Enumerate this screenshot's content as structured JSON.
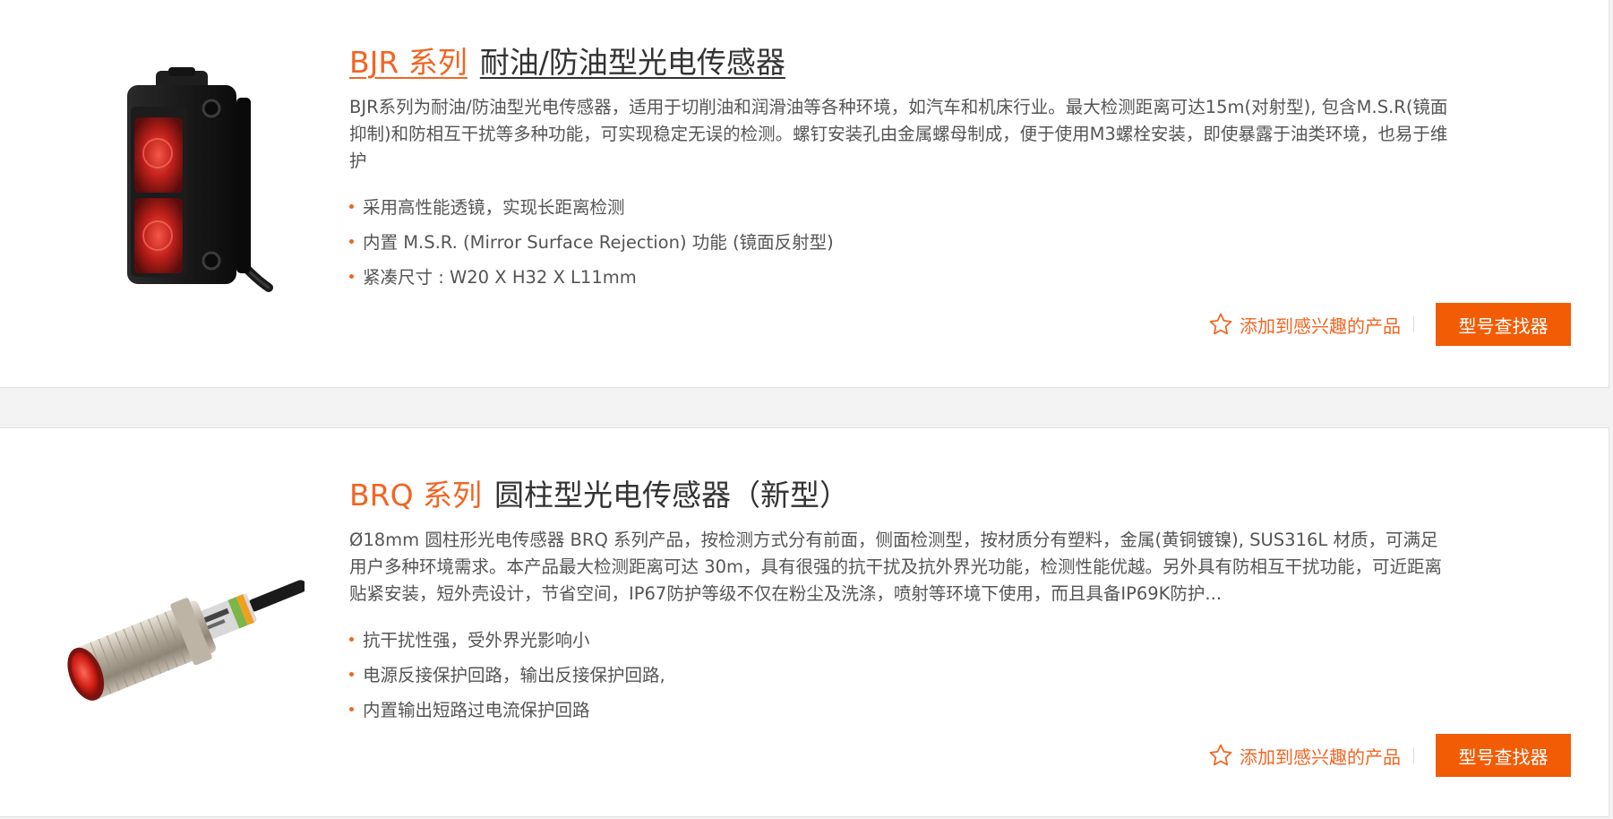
{
  "products": [
    {
      "series": "BJR 系列",
      "name": "耐油/防油型光电传感器",
      "description": "BJR系列为耐油/防油型光电传感器，适用于切削油和润滑油等各种环境，如汽车和机床行业。最大检测距离可达15m(对射型), 包含M.S.R(镜面抑制)和防相互干扰等多种功能，可实现稳定无误的检测。螺钉安装孔由金属螺母制成，便于使用M3螺栓安装，即使暴露于油类环境，也易于维护",
      "features": [
        "采用高性能透镜，实现长距离检测",
        "内置 M.S.R. (Mirror Surface Rejection) 功能 (镜面反射型)",
        "紧凑尺寸 : W20 X H32 X L11mm"
      ],
      "favorite_label": "添加到感兴趣的产品",
      "finder_label": "型号查找器"
    },
    {
      "series": "BRQ 系列",
      "name": "圆柱型光电传感器（新型）",
      "description": "Ø18mm 圆柱形光电传感器 BRQ 系列产品，按检测方式分有前面，侧面检测型，按材质分有塑料，金属(黄铜镀镍), SUS316L 材质，可满足用户多种环境需求。本产品最大检测距离可达 30m，具有很强的抗干扰及抗外界光功能，检测性能优越。另外具有防相互干扰功能，可近距离贴紧安装，短外壳设计，节省空间，IP67防护等级不仅在粉尘及洗涤，喷射等环境下使用，而且具备IP69K防护...",
      "features": [
        "抗干扰性强，受外界光影响小",
        "电源反接保护回路，输出反接保护回路,",
        "内置输出短路过电流保护回路"
      ],
      "favorite_label": "添加到感兴趣的产品",
      "finder_label": "型号查找器"
    }
  ],
  "colors": {
    "accent": "#f26522",
    "button": "#f25c05",
    "text": "#555555",
    "title": "#333333"
  },
  "icons": {
    "favorite": "star-outline-icon"
  }
}
